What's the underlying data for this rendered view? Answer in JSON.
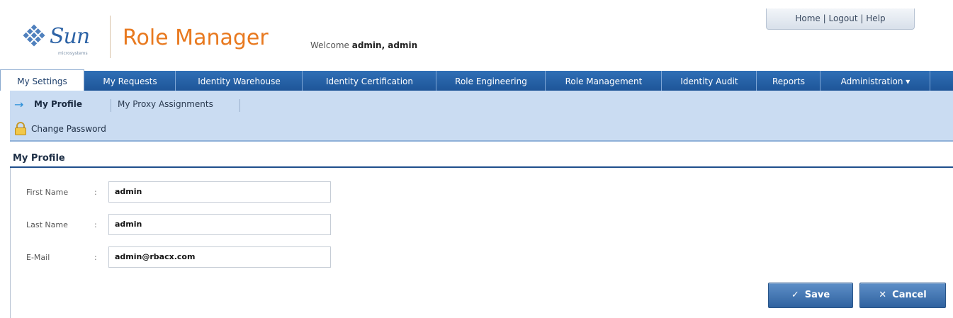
{
  "header": {
    "logo_text": "Sun",
    "logo_sub": "microsystems",
    "app_title": "Role Manager",
    "welcome_prefix": "Welcome",
    "welcome_user": "admin, admin",
    "toplinks": {
      "home": "Home",
      "logout": "Logout",
      "help": "Help",
      "sep": "|"
    }
  },
  "nav": {
    "tabs": [
      {
        "label": "My Settings",
        "active": true
      },
      {
        "label": "My Requests"
      },
      {
        "label": "Identity Warehouse"
      },
      {
        "label": "Identity Certification"
      },
      {
        "label": "Role Engineering"
      },
      {
        "label": "Role Management"
      },
      {
        "label": "Identity Audit"
      },
      {
        "label": "Reports"
      },
      {
        "label": "Administration ▾"
      }
    ]
  },
  "subnav": {
    "active_label": "My Profile",
    "items": [
      "My Proxy Assignments"
    ],
    "action_label": "Change Password"
  },
  "section": {
    "title": "My Profile"
  },
  "form": {
    "fields": [
      {
        "label": "First Name",
        "colon": ":",
        "value": "admin"
      },
      {
        "label": "Last Name",
        "colon": ":",
        "value": "admin"
      },
      {
        "label": "E-Mail",
        "colon": ":",
        "value": "admin@rbacx.com"
      }
    ],
    "save_label": "Save",
    "cancel_label": "Cancel",
    "save_icon": "check-icon",
    "cancel_icon": "x-icon"
  },
  "colors": {
    "nav_bg": "#1e5598",
    "subnav_bg": "#cadcf2",
    "title_orange": "#e8791f",
    "button_blue": "#2f629f"
  }
}
